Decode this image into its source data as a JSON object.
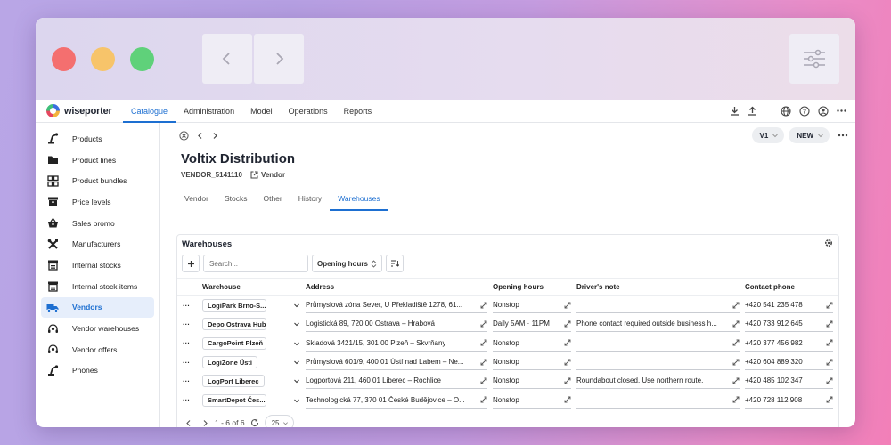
{
  "app": {
    "logo_text": "wiseporter"
  },
  "main_nav": [
    {
      "label": "Catalogue",
      "active": true
    },
    {
      "label": "Administration"
    },
    {
      "label": "Model"
    },
    {
      "label": "Operations"
    },
    {
      "label": "Reports"
    }
  ],
  "sidebar": [
    {
      "label": "Products",
      "icon": "robot-arm-icon"
    },
    {
      "label": "Product lines",
      "icon": "folder-icon"
    },
    {
      "label": "Product bundles",
      "icon": "grid-icon"
    },
    {
      "label": "Price levels",
      "icon": "archive-icon"
    },
    {
      "label": "Sales promo",
      "icon": "basket-icon"
    },
    {
      "label": "Manufacturers",
      "icon": "tools-icon"
    },
    {
      "label": "Internal stocks",
      "icon": "warehouse-icon"
    },
    {
      "label": "Internal stock items",
      "icon": "warehouse-icon"
    },
    {
      "label": "Vendors",
      "icon": "truck-icon",
      "active": true
    },
    {
      "label": "Vendor warehouses",
      "icon": "headset-icon"
    },
    {
      "label": "Vendor offers",
      "icon": "headset-icon"
    },
    {
      "label": "Phones",
      "icon": "robot-arm-icon"
    }
  ],
  "header": {
    "version_pill": "V1",
    "status_pill": "NEW",
    "title": "Voltix Distribution",
    "code": "VENDOR_5141110",
    "type_label": "Vendor"
  },
  "tabs": [
    {
      "label": "Vendor"
    },
    {
      "label": "Stocks"
    },
    {
      "label": "Other"
    },
    {
      "label": "History"
    },
    {
      "label": "Warehouses",
      "active": true
    }
  ],
  "warehouses": {
    "title": "Warehouses",
    "search_placeholder": "Search...",
    "filter_select": "Opening hours",
    "columns": [
      "Warehouse",
      "Address",
      "Opening hours",
      "Driver's note",
      "Contact phone"
    ],
    "rows": [
      {
        "warehouse": "LogiPark Brno-S...",
        "address": "Průmyslová zóna Sever, U Překladiště 1278, 61...",
        "hours": "Nonstop",
        "note": "",
        "phone": "+420 541 235 478"
      },
      {
        "warehouse": "Depo Ostrava Hub",
        "address": "Logistická 89, 720 00 Ostrava – Hrabová",
        "hours": "Daily 5AM · 11PM",
        "note": "Phone contact required outside business h...",
        "phone": "+420 733 912 645"
      },
      {
        "warehouse": "CargoPoint Plzeň",
        "address": "Skladová 3421/15, 301 00 Plzeň – Skvrňany",
        "hours": "Nonstop",
        "note": "",
        "phone": "+420 377 456 982"
      },
      {
        "warehouse": "LogiZone Ústí",
        "address": "Průmyslová 601/9, 400 01 Ústí nad Labem – Ne...",
        "hours": "Nonstop",
        "note": "",
        "phone": "+420 604 889 320"
      },
      {
        "warehouse": "LogPort Liberec",
        "address": "Logportová 211, 460 01 Liberec – Rochlice",
        "hours": "Nonstop",
        "note": "Roundabout closed. Use northern route.",
        "phone": "+420 485 102 347"
      },
      {
        "warehouse": "SmartDepot Čes...",
        "address": "Technologická 77, 370 01 České Budějovice – O...",
        "hours": "Nonstop",
        "note": "",
        "phone": "+420 728 112 908"
      }
    ],
    "pager_text": "1 - 6 of 6",
    "page_size": "25"
  },
  "colors": {
    "accent": "#1d6fd1",
    "active_bg": "#e6eefb"
  }
}
